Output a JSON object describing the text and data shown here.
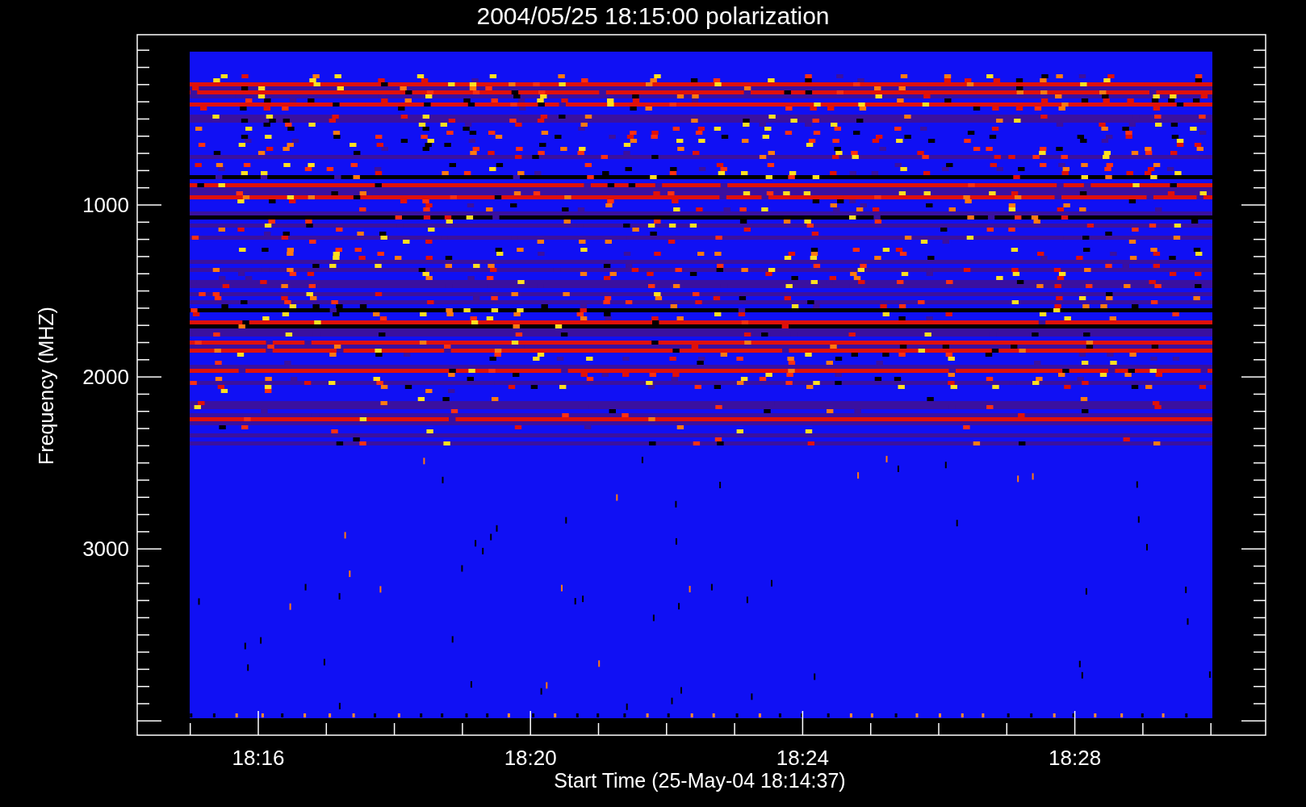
{
  "title": "2004/05/25 18:15:00 polarization",
  "plot": {
    "ylabel": "Frequency (MHZ)",
    "xlabel": "Start Time (25-May-04 18:14:37)",
    "yticks": [
      "1000",
      "2000",
      "3000"
    ],
    "xticks": [
      "18:16",
      "18:20",
      "18:24",
      "18:28"
    ]
  }
}
